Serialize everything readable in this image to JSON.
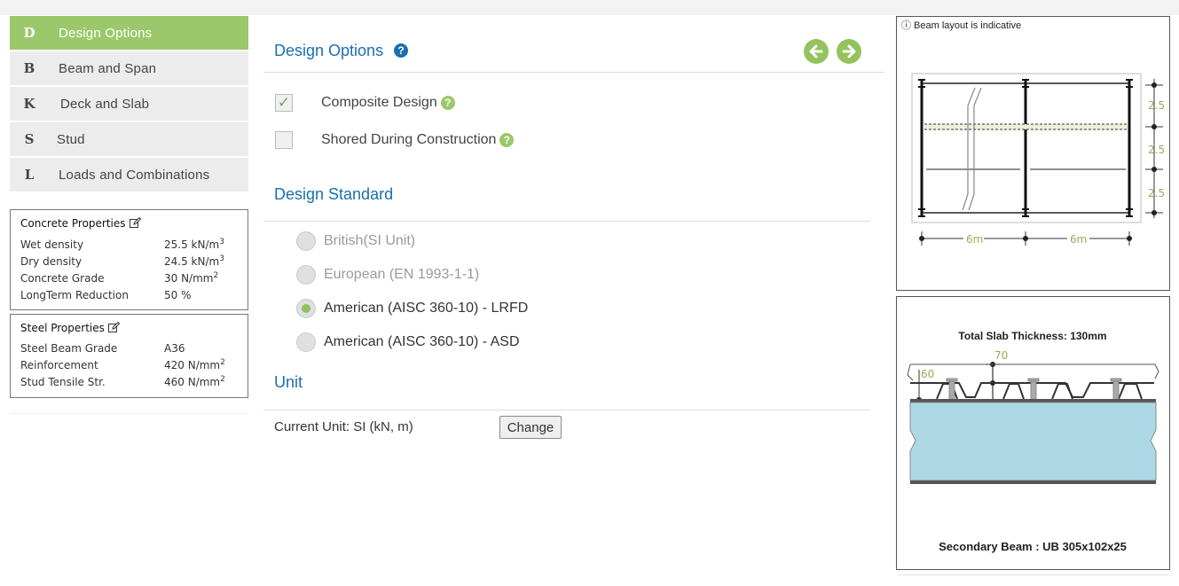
{
  "nav": {
    "items": [
      {
        "letter": "D",
        "label": "Design Options",
        "active": true
      },
      {
        "letter": "B",
        "label": "Beam and Span"
      },
      {
        "letter": "K",
        "label": "Deck and Slab"
      },
      {
        "letter": "S",
        "label": "Stud"
      },
      {
        "letter": "L",
        "label": "Loads and Combinations"
      }
    ]
  },
  "concrete": {
    "title": "Concrete Properties",
    "rows": [
      {
        "label": "Wet density",
        "value": "25.5 kN/m",
        "sup": "3"
      },
      {
        "label": "Dry density",
        "value": "24.5 kN/m",
        "sup": "3"
      },
      {
        "label": "Concrete Grade",
        "value": "30 N/mm",
        "sup": "2"
      },
      {
        "label": "LongTerm Reduction",
        "value": "50 %",
        "sup": ""
      }
    ]
  },
  "steel": {
    "title": "Steel Properties",
    "rows": [
      {
        "label": "Steel Beam Grade",
        "value": "A36",
        "sup": ""
      },
      {
        "label": "Reinforcement",
        "value": "420 N/mm",
        "sup": "2"
      },
      {
        "label": "Stud Tensile Str.",
        "value": "460 N/mm",
        "sup": "2"
      }
    ]
  },
  "main": {
    "title": "Design Options",
    "help": "?",
    "composite_label": "Composite Design",
    "composite_checked": true,
    "shored_label": "Shored During Construction",
    "shored_checked": false,
    "check_mark": "✓",
    "standard_title": "Design Standard",
    "standards": [
      {
        "label": "British(SI Unit)",
        "state": "disabled"
      },
      {
        "label": "European (EN 1993-1-1)",
        "state": "disabled"
      },
      {
        "label": "American (AISC 360-10) - LRFD",
        "state": "selected"
      },
      {
        "label": "American (AISC 360-10) - ASD",
        "state": "enabled"
      }
    ],
    "unit_title": "Unit",
    "current_unit": "Current Unit: SI (kN, m)",
    "change_label": "Change"
  },
  "layout": {
    "note": "ⓘ Beam layout is indicative",
    "spacings": [
      "2.5",
      "2.5",
      "2.5"
    ],
    "spans": [
      "6m",
      "6m"
    ],
    "accent": "#8fb35a"
  },
  "section": {
    "title": "Total Slab Thickness: 130mm",
    "dim_top": "70",
    "dim_side": "60",
    "beam": "Secondary Beam : UB 305x102x25"
  },
  "colors": {
    "nav_active": "#9bc86a",
    "heading_blue": "#1a6fb0",
    "green": "#93c35f",
    "concrete_fill": "#add8e6"
  }
}
